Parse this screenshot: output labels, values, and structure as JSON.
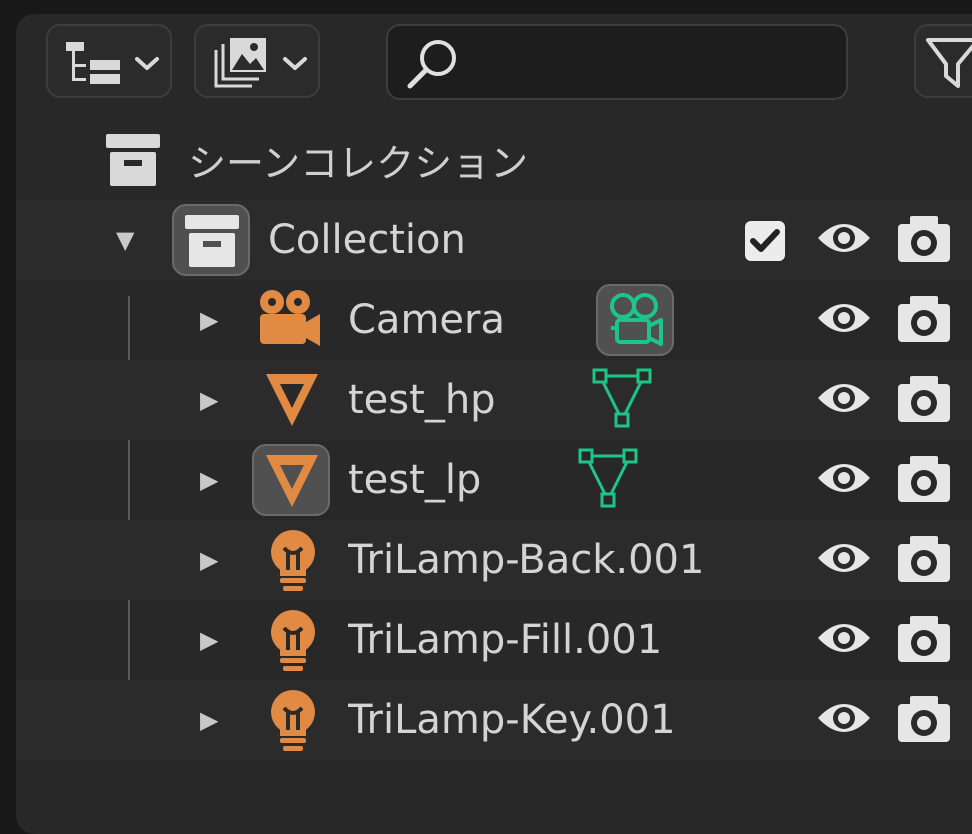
{
  "colors": {
    "object_orange": "#e08a44",
    "data_teal": "#1ec48a",
    "icon_light": "#d9d9d9"
  },
  "header": {
    "display_mode_icon": "outliner-tree-icon",
    "filter_icon": "image-stack-icon",
    "search_icon": "magnifier-icon",
    "search_value": "",
    "filter_button_icon": "funnel-icon"
  },
  "scene_collection": {
    "label": "シーンコレクション",
    "icon": "collection-box-icon"
  },
  "collection": {
    "label": "Collection",
    "expanded": true,
    "exclude_checked": true,
    "icon": "collection-box-icon"
  },
  "objects": [
    {
      "label": "Camera",
      "icon": "camera-object-icon",
      "data_icon": "camera-data-icon",
      "active_icon": true
    },
    {
      "label": "test_hp",
      "icon": "mesh-object-icon",
      "data_icon": "mesh-data-icon",
      "active_icon": false
    },
    {
      "label": "test_lp",
      "icon": "mesh-object-icon",
      "data_icon": "mesh-data-icon",
      "active_icon": true
    },
    {
      "label": "TriLamp-Back.001",
      "icon": "light-object-icon",
      "active_icon": false
    },
    {
      "label": "TriLamp-Fill.001",
      "icon": "light-object-icon",
      "active_icon": false
    },
    {
      "label": "TriLamp-Key.001",
      "icon": "light-object-icon",
      "active_icon": false
    }
  ]
}
